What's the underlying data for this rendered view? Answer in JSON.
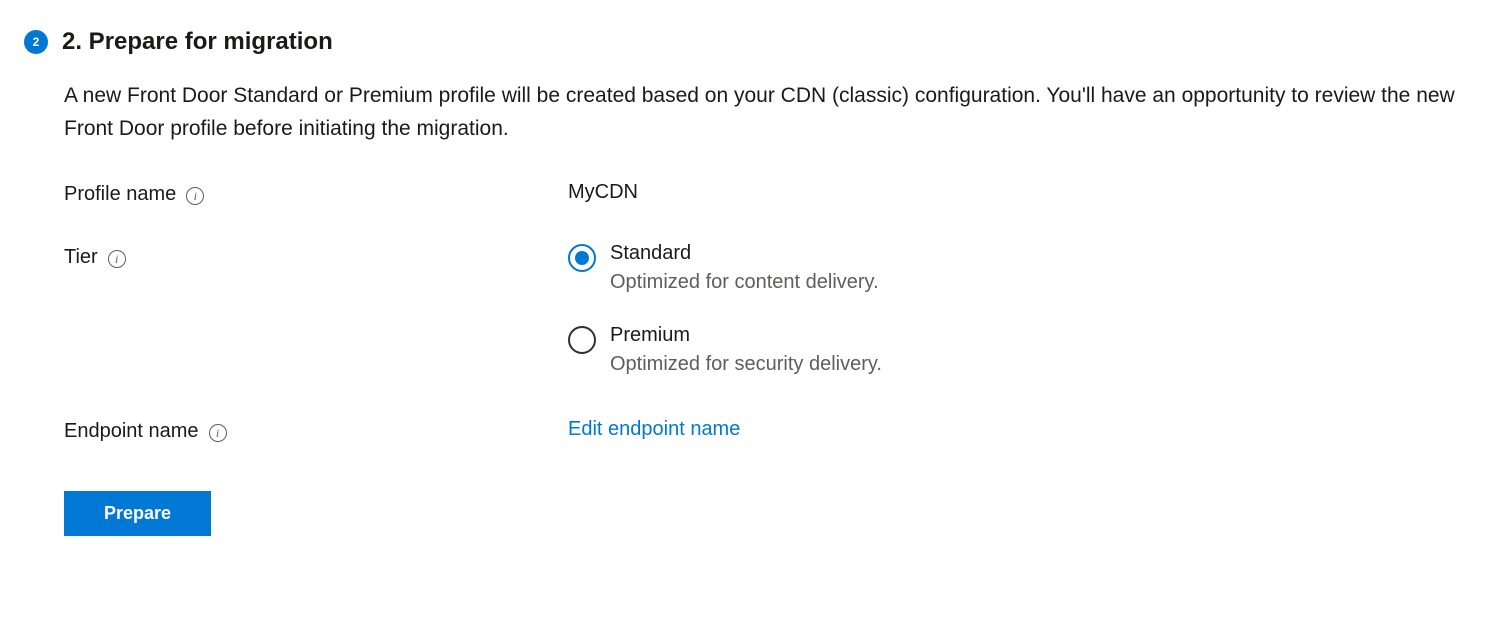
{
  "step": {
    "number": "2",
    "title": "2. Prepare for migration",
    "description": "A new Front Door Standard or Premium profile will be created based on your CDN (classic) configuration. You'll have an opportunity to review the new Front Door profile before initiating the migration."
  },
  "form": {
    "profileName": {
      "label": "Profile name",
      "value": "MyCDN"
    },
    "tier": {
      "label": "Tier",
      "options": [
        {
          "label": "Standard",
          "description": "Optimized for content delivery.",
          "selected": true
        },
        {
          "label": "Premium",
          "description": "Optimized for security delivery.",
          "selected": false
        }
      ]
    },
    "endpointName": {
      "label": "Endpoint name",
      "linkText": "Edit endpoint name"
    }
  },
  "actions": {
    "prepare": "Prepare"
  }
}
